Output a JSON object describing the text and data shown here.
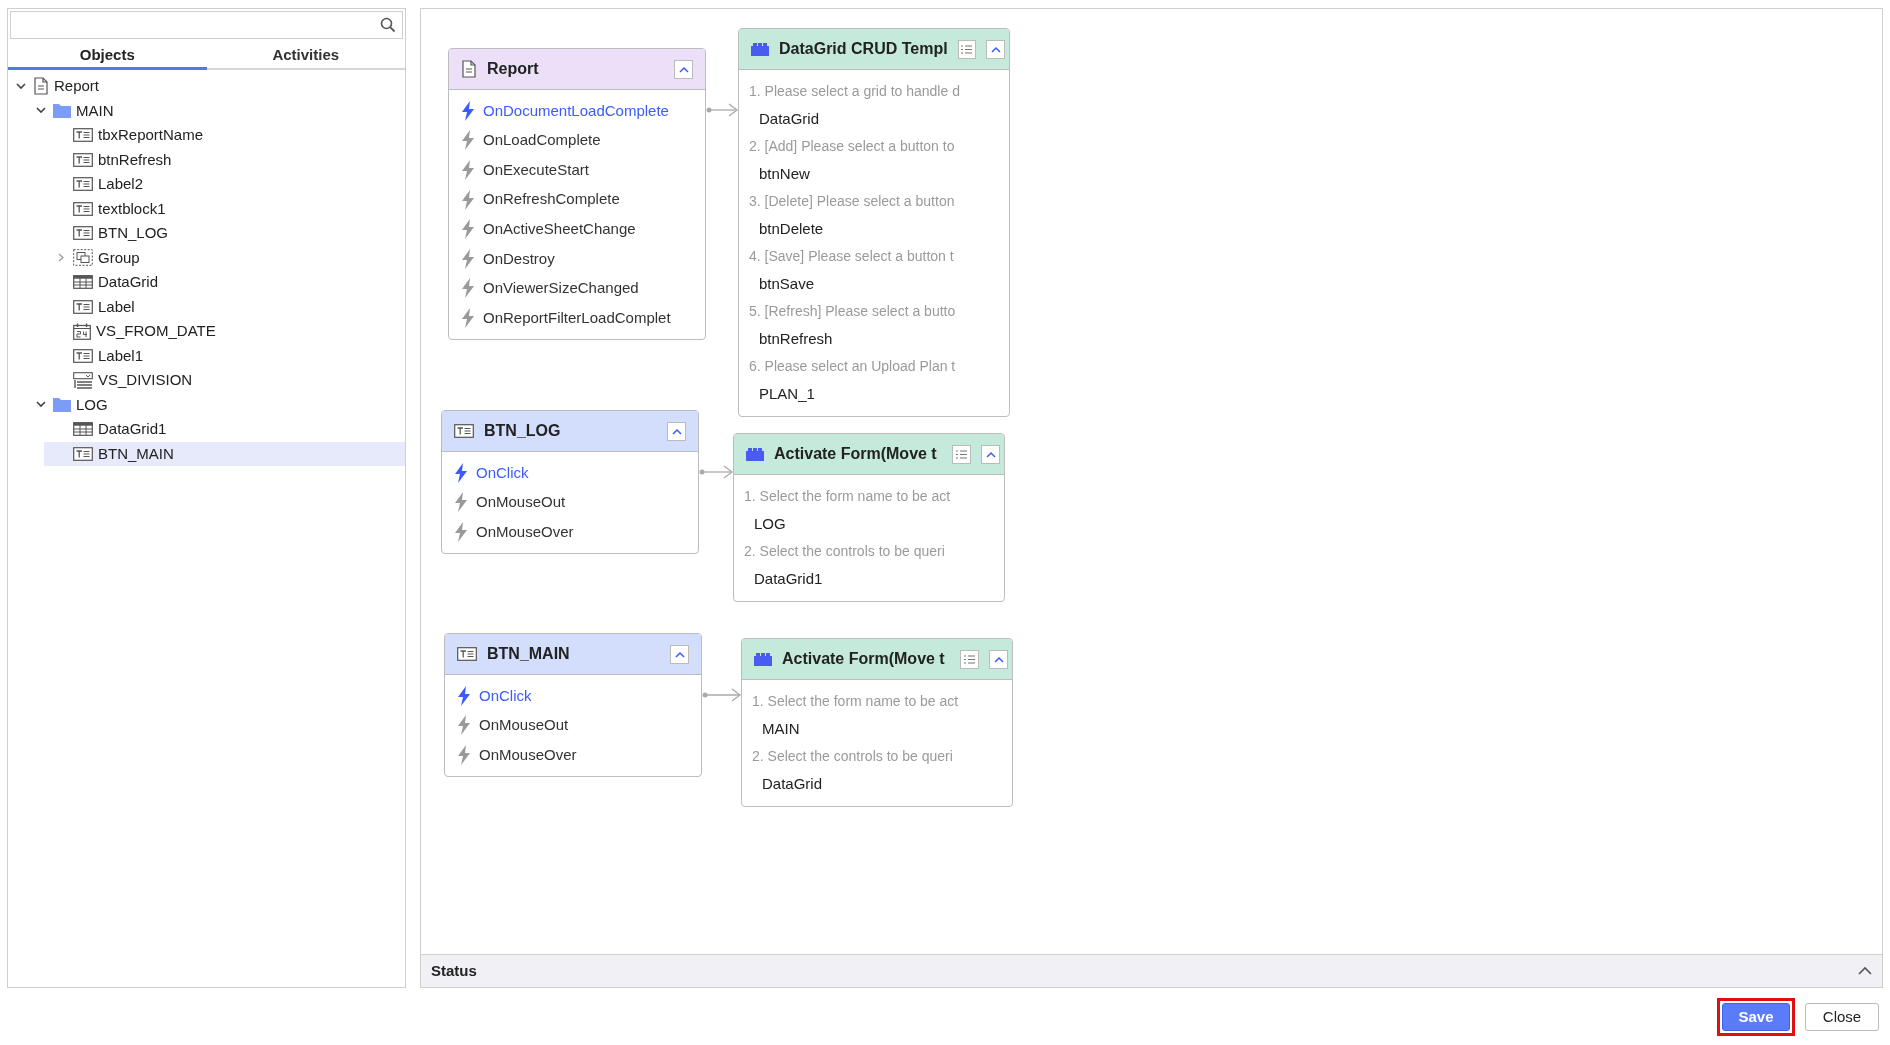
{
  "tabs": [
    {
      "label": "Objects",
      "selected": true
    },
    {
      "label": "Activities",
      "selected": false
    }
  ],
  "tree": [
    {
      "label": "Report",
      "kind": "report",
      "expanded": true,
      "selected": false,
      "children": [
        {
          "label": "MAIN",
          "kind": "folder",
          "expanded": true,
          "selected": false,
          "children": [
            {
              "label": "tbxReportName",
              "kind": "textbox",
              "selected": false
            },
            {
              "label": "btnRefresh",
              "kind": "textbox",
              "selected": false
            },
            {
              "label": "Label2",
              "kind": "textbox",
              "selected": false
            },
            {
              "label": "textblock1",
              "kind": "textbox",
              "selected": false
            },
            {
              "label": "BTN_LOG",
              "kind": "textbox",
              "selected": false
            },
            {
              "label": "Group",
              "kind": "group",
              "expanded": false,
              "selected": false
            },
            {
              "label": "DataGrid",
              "kind": "grid",
              "selected": false
            },
            {
              "label": "Label",
              "kind": "textbox",
              "selected": false
            },
            {
              "label": "VS_FROM_DATE",
              "kind": "date",
              "selected": false
            },
            {
              "label": "Label1",
              "kind": "textbox",
              "selected": false
            },
            {
              "label": "VS_DIVISION",
              "kind": "combo",
              "selected": false
            }
          ]
        },
        {
          "label": "LOG",
          "kind": "folder",
          "expanded": true,
          "selected": false,
          "children": [
            {
              "label": "DataGrid1",
              "kind": "grid",
              "selected": false
            },
            {
              "label": "BTN_MAIN",
              "kind": "textbox",
              "selected": true
            }
          ]
        }
      ]
    }
  ],
  "flows": [
    {
      "source": {
        "title": "Report",
        "kind": "report",
        "events": [
          {
            "label": "OnDocumentLoadComplete",
            "bound": true
          },
          {
            "label": "OnLoadComplete",
            "bound": false
          },
          {
            "label": "OnExecuteStart",
            "bound": false
          },
          {
            "label": "OnRefreshComplete",
            "bound": false
          },
          {
            "label": "OnActiveSheetChange",
            "bound": false
          },
          {
            "label": "OnDestroy",
            "bound": false
          },
          {
            "label": "OnViewerSizeChanged",
            "bound": false
          },
          {
            "label": "OnReportFilterLoadComplet",
            "bound": false
          }
        ]
      },
      "action": {
        "title": "DataGrid CRUD Templ",
        "params": [
          {
            "prompt": "1. Please select a grid to handle d",
            "value": "DataGrid"
          },
          {
            "prompt": "2. [Add] Please select a button to",
            "value": "btnNew"
          },
          {
            "prompt": "3. [Delete] Please select a button",
            "value": "btnDelete"
          },
          {
            "prompt": "4. [Save] Please select a button t",
            "value": "btnSave"
          },
          {
            "prompt": "5. [Refresh] Please select a butto",
            "value": "btnRefresh"
          },
          {
            "prompt": "6. Please select an Upload Plan t",
            "value": "PLAN_1"
          }
        ]
      }
    },
    {
      "source": {
        "title": "BTN_LOG",
        "kind": "button",
        "events": [
          {
            "label": "OnClick",
            "bound": true
          },
          {
            "label": "OnMouseOut",
            "bound": false
          },
          {
            "label": "OnMouseOver",
            "bound": false
          }
        ]
      },
      "action": {
        "title": "Activate Form(Move t",
        "params": [
          {
            "prompt": "1. Select the form name to be act",
            "value": "LOG"
          },
          {
            "prompt": "2. Select the controls to be queri",
            "value": "DataGrid1"
          }
        ]
      }
    },
    {
      "source": {
        "title": "BTN_MAIN",
        "kind": "button",
        "events": [
          {
            "label": "OnClick",
            "bound": true
          },
          {
            "label": "OnMouseOut",
            "bound": false
          },
          {
            "label": "OnMouseOver",
            "bound": false
          }
        ]
      },
      "action": {
        "title": "Activate Form(Move t",
        "params": [
          {
            "prompt": "1. Select the form name to be act",
            "value": "MAIN"
          },
          {
            "prompt": "2. Select the controls to be queri",
            "value": "DataGrid"
          }
        ]
      }
    }
  ],
  "status_panel": {
    "title": "Status"
  },
  "buttons": [
    {
      "label": "Save",
      "kind": "primary",
      "highlighted": true
    },
    {
      "label": "Close",
      "kind": "secondary",
      "highlighted": false
    }
  ]
}
